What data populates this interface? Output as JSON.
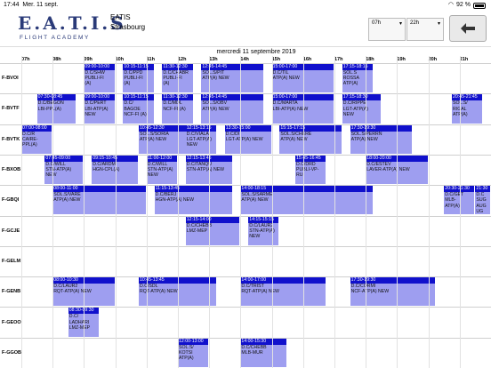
{
  "status": {
    "time": "17:44",
    "date": "Mer. 11 sept.",
    "battery": "92 %"
  },
  "org": {
    "name": "EATIS",
    "city": "Strasbourg"
  },
  "logo": {
    "word": "E.A.T.I.S",
    "sub": "FLIGHT ACADEMY"
  },
  "range": {
    "from": "07h",
    "to": "22h"
  },
  "day_title": "mercredi 11 septembre 2019",
  "hours": [
    "07h",
    "08h",
    "09h",
    "10h",
    "11h",
    "12h",
    "13h",
    "14h",
    "15h",
    "16h",
    "17h",
    "18h",
    "19h",
    "20h",
    "21h"
  ],
  "rows": [
    "F-BVOI",
    "F-BVTF",
    "F-BVTK",
    "F-BXOB",
    "F-GBQI",
    "F-GCJE",
    "F-GELM",
    "F-GENB",
    "F-GEOO",
    "F-GGOB"
  ],
  "blocks": [
    {
      "row": 0,
      "start": 9.0,
      "end": 10.0,
      "time": "09:00-10:00",
      "text": "D.C/SHW\nPUBLI-FI\n(A)"
    },
    {
      "row": 0,
      "start": 10.25,
      "end": 11.25,
      "time": "10:15-11:15",
      "text": "D.C/PPD\nPUBLI-FI\n(A)"
    },
    {
      "row": 0,
      "start": 11.5,
      "end": 12.5,
      "time": "11:30-12:30",
      "text": "D.C/CHABR\nPUBLI-FI\n(A)"
    },
    {
      "row": 0,
      "start": 12.75,
      "end": 14.75,
      "time": "12:45-14:45",
      "text": "SOL.S/PIT\nATP(A) NEW"
    },
    {
      "row": 0,
      "start": 15.0,
      "end": 17.0,
      "time": "15:00-17:00",
      "text": "D.C/TIL\nATP(A) NEW"
    },
    {
      "row": 0,
      "start": 17.25,
      "end": 18.25,
      "time": "17:15-18:15",
      "text": "SOL.S\nROSSA\nATP(A)"
    },
    {
      "row": 1,
      "start": 7.5,
      "end": 8.75,
      "time": "07:30-08:45",
      "text": "D.C/BEGON\nLBI-PPL(A)"
    },
    {
      "row": 1,
      "start": 9.0,
      "end": 10.0,
      "time": "09:00-10:00",
      "text": "D.C/PERT\nLBI-ATP(A)\nNEW"
    },
    {
      "row": 1,
      "start": 10.25,
      "end": 11.25,
      "time": "10:15-11:15",
      "text": "D.C/\nBAGOE\nNCF-FI (A)"
    },
    {
      "row": 1,
      "start": 11.5,
      "end": 12.5,
      "time": "11:30-12:30",
      "text": "D.C/MDL\nNCF-FI (A)"
    },
    {
      "row": 1,
      "start": 12.75,
      "end": 14.75,
      "time": "12:45-14:45",
      "text": "SOL.S/OBV\nATP(A) NEW"
    },
    {
      "row": 1,
      "start": 15.0,
      "end": 17.0,
      "time": "15:00-17:00",
      "text": "D.C/MARTA\nLBI-ATP(A) NEW"
    },
    {
      "row": 1,
      "start": 17.25,
      "end": 18.5,
      "time": "17:15-18:30",
      "text": "D.C/RIPPE\nLGT-ATP(A)\nNEW"
    },
    {
      "row": 1,
      "start": 20.75,
      "end": 21.75,
      "time": "20:45-21:45",
      "text": "SOL.S/\nRIGAL\nATP(A)"
    },
    {
      "row": 2,
      "start": 7.0,
      "end": 8.0,
      "time": "07:00-08:00",
      "text": "D.C/R\nCAIRE-\nPPL(A)"
    },
    {
      "row": 2,
      "start": 10.75,
      "end": 12.5,
      "time": "10:45-12:30",
      "text": "SOL.S/SORIA\nATP(A) NEW"
    },
    {
      "row": 2,
      "start": 12.25,
      "end": 13.25,
      "time": "12:15-13:15",
      "text": "D.C/VIALA\nLGT-ATP(A)\nNEW"
    },
    {
      "row": 2,
      "start": 13.5,
      "end": 15.0,
      "time": "13:30-15:00",
      "text": "D.C/DI\nLGT-ATP(A) NEW"
    },
    {
      "row": 2,
      "start": 15.25,
      "end": 17.25,
      "time": "15:15-17:15",
      "text": "SOL.S/CHERE\nATP(A) NEW"
    },
    {
      "row": 2,
      "start": 17.5,
      "end": 19.5,
      "time": "17:30-19:30",
      "text": "SOL.S/PERRN\nATP(A) NEW"
    },
    {
      "row": 3,
      "start": 7.75,
      "end": 9.0,
      "time": "07:45-09:00",
      "text": "D.C/WILL\nSTN-ATP(A)\nNEW"
    },
    {
      "row": 3,
      "start": 9.25,
      "end": 10.75,
      "time": "09:15-10:45",
      "text": "D.C/ARDM\nHGN-CPL(A)"
    },
    {
      "row": 3,
      "start": 11.0,
      "end": 12.0,
      "time": "11:00-12:00",
      "text": "D.C/WILL\nSTN-ATP(A)\nNEW"
    },
    {
      "row": 3,
      "start": 12.25,
      "end": 13.75,
      "time": "12:15-13:45",
      "text": "D.C/TANQU\nSTN-ATP(A) NEW"
    },
    {
      "row": 3,
      "start": 15.75,
      "end": 16.75,
      "time": "15:45-16:45",
      "text": "D.C/DRD\nPUBLI-VP-\nRU."
    },
    {
      "row": 3,
      "start": 18.0,
      "end": 20.0,
      "time": "18:00-20:00",
      "text": "D.C/ESTEV\nLAVER-ATP(A) NEW"
    },
    {
      "row": 4,
      "start": 8.0,
      "end": 11.0,
      "time": "08:00-11:00",
      "text": "SOL.S/VARE\nATP(A) NEW"
    },
    {
      "row": 4,
      "start": 11.25,
      "end": 13.75,
      "time": "11:15-13:45",
      "text": "D.C/BERJ\nHGN-ATP(A) NEW"
    },
    {
      "row": 4,
      "start": 14.0,
      "end": 18.25,
      "time": "14:00-18:15",
      "text": "SOL.S/SARME\nATP(A) NEW"
    },
    {
      "row": 4,
      "start": 20.5,
      "end": 21.5,
      "time": "20:30-21:30",
      "text": "D.C/GET\nMLB-\nATP(A)"
    },
    {
      "row": 4,
      "start": 21.5,
      "end": 22.0,
      "time": "21:30",
      "text": "D.C\nSUG\nAUG\nUG"
    },
    {
      "row": 5,
      "start": 12.25,
      "end": 14.0,
      "time": "12:15-14:00",
      "text": "D.C/CHEBB\nLMZ-MEP"
    },
    {
      "row": 5,
      "start": 14.25,
      "end": 15.25,
      "time": "14:15-15:15",
      "text": "D.C/LAUR2\nSTN-ATP(A)\nNEW"
    },
    {
      "row": 7,
      "start": 8.0,
      "end": 10.0,
      "time": "08:00-10:30",
      "text": "D.C/LAUR2\nRQT-ATP(A) NEW"
    },
    {
      "row": 7,
      "start": 10.75,
      "end": 13.25,
      "time": "10:45-13:45",
      "text": "D.C/SDL\nRQT-ATP(A) NEW"
    },
    {
      "row": 7,
      "start": 14.0,
      "end": 16.75,
      "time": "14:00-17:00",
      "text": "D.C/TRIST\nRQT-ATP(A) NEW"
    },
    {
      "row": 7,
      "start": 17.5,
      "end": 20.25,
      "time": "17:30-19:30",
      "text": "D.C/CORMI\nNCF-ATP(A) NEW"
    },
    {
      "row": 8,
      "start": 8.5,
      "end": 9.5,
      "time": "08:30-09:30",
      "text": "D.C/\nLADHARI\nLMZ-MEP"
    },
    {
      "row": 9,
      "start": 12.0,
      "end": 13.0,
      "time": "12:00-13:00",
      "text": "SOL.S/\nKOTSI\nATP(A)"
    },
    {
      "row": 9,
      "start": 14.0,
      "end": 15.5,
      "time": "14:00-15:30",
      "text": "D.C/CHEBB\nMLB-MUR"
    }
  ]
}
